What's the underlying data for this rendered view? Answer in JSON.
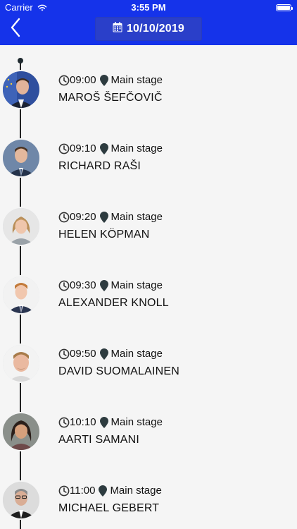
{
  "status_bar": {
    "carrier": "Carrier",
    "time": "3:55 PM"
  },
  "header": {
    "back_icon": "chevron-left-icon",
    "date_icon": "calendar-icon",
    "date": "10/10/2019",
    "background": "#1533ea",
    "date_button_color": "#2a3fc9"
  },
  "schedule": [
    {
      "time": "09:00",
      "location": "Main stage",
      "speaker": "MAROŠ ŠEFČOVIČ"
    },
    {
      "time": "09:10",
      "location": "Main stage",
      "speaker": "RICHARD RAŠI"
    },
    {
      "time": "09:20",
      "location": "Main stage",
      "speaker": "HELEN KÖPMAN"
    },
    {
      "time": "09:30",
      "location": "Main stage",
      "speaker": "ALEXANDER KNOLL"
    },
    {
      "time": "09:50",
      "location": "Main stage",
      "speaker": "DAVID SUOMALAINEN"
    },
    {
      "time": "10:10",
      "location": "Main stage",
      "speaker": "AARTI SAMANI"
    },
    {
      "time": "11:00",
      "location": "Main stage",
      "speaker": "MICHAEL GEBERT"
    }
  ]
}
